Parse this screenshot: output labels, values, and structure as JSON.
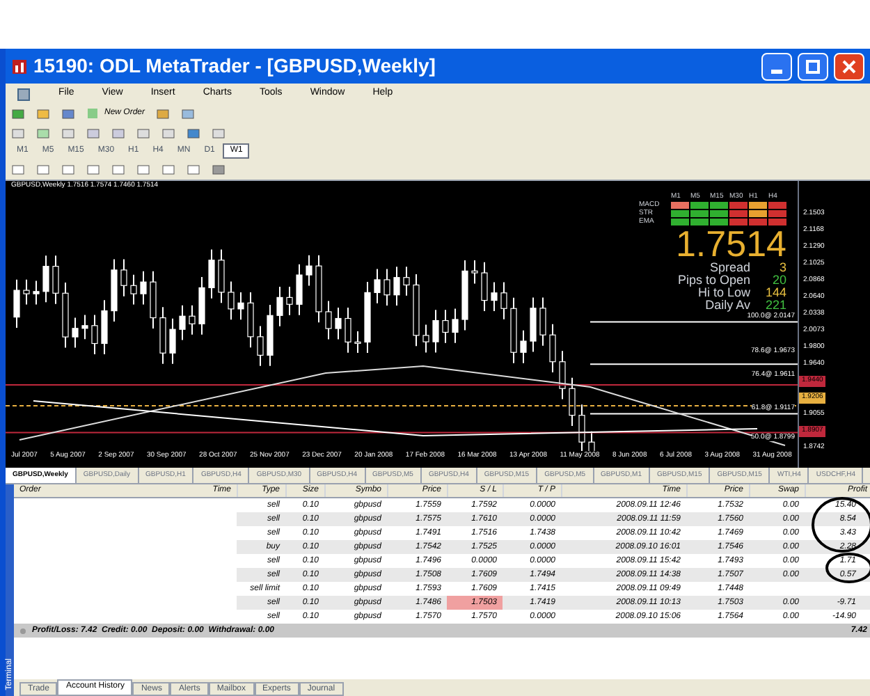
{
  "window": {
    "title": "15190: ODL MetaTrader - [GBPUSD,Weekly]"
  },
  "menu": [
    "File",
    "View",
    "Insert",
    "Charts",
    "Tools",
    "Window",
    "Help"
  ],
  "toolbar": {
    "new_order": "New Order"
  },
  "periods": [
    {
      "label": "M1",
      "selected": false
    },
    {
      "label": "M5",
      "selected": false
    },
    {
      "label": "M15",
      "selected": false
    },
    {
      "label": "M30",
      "selected": false
    },
    {
      "label": "H1",
      "selected": false
    },
    {
      "label": "H4",
      "selected": false
    },
    {
      "label": "MN",
      "selected": false
    },
    {
      "label": "D1",
      "selected": false
    },
    {
      "label": "W1",
      "selected": true
    }
  ],
  "chart": {
    "header": "GBPUSD,Weekly 1.7516 1.7574 1.7460 1.7514",
    "y_labels": [
      {
        "text": "2.1503",
        "kind": "tick"
      },
      {
        "text": "2.1168",
        "kind": "tick"
      },
      {
        "text": "2.1290",
        "kind": "tick"
      },
      {
        "text": "2.1025",
        "kind": "tick"
      },
      {
        "text": "2.0868",
        "kind": "tick"
      },
      {
        "text": "2.0640",
        "kind": "tick"
      },
      {
        "text": "2.0338",
        "kind": "tick"
      },
      {
        "text": "2.0073",
        "kind": "tick"
      },
      {
        "text": "1.9800",
        "kind": "tick"
      },
      {
        "text": "1.9640",
        "kind": "tick"
      },
      {
        "text": "1.9440",
        "kind": "badge",
        "color": "#c0283c"
      },
      {
        "text": "1.9206",
        "kind": "badge",
        "color": "#e8b040"
      },
      {
        "text": "1.9055",
        "kind": "tick"
      },
      {
        "text": "1.8907",
        "kind": "badge",
        "color": "#c0283c"
      },
      {
        "text": "1.8742",
        "kind": "tick"
      }
    ],
    "x_labels": [
      "Jul 2007",
      "5 Aug 2007",
      "2 Sep 2007",
      "30 Sep 2007",
      "28 Oct 2007",
      "25 Nov 2007",
      "23 Dec 2007",
      "20 Jan 2008",
      "17 Feb 2008",
      "16 Mar 2008",
      "13 Apr 2008",
      "11 May 2008",
      "8 Jun 2008",
      "6 Jul 2008",
      "3 Aug 2008",
      "31 Aug 2008"
    ],
    "fib_labels": [
      "100.0@ 2.0147",
      "78.6@ 1.9673",
      "76.4@ 1.9611",
      "61.8@ 1.9117",
      "50.0@ 1.8799"
    ],
    "signals": {
      "timeframes": [
        "M1",
        "M5",
        "M15",
        "M30",
        "H1",
        "H4"
      ],
      "rows": [
        {
          "name": "MACD",
          "cells": [
            {
              "color": "#e87060"
            },
            {
              "color": "#30b030"
            },
            {
              "color": "#30b030"
            },
            {
              "color": "#d03030"
            },
            {
              "color": "#e8a030"
            },
            {
              "color": "#d03030"
            }
          ]
        },
        {
          "name": "STR",
          "cells": [
            {
              "color": "#30b030"
            },
            {
              "color": "#30b030"
            },
            {
              "color": "#30b030"
            },
            {
              "color": "#d03030"
            },
            {
              "color": "#e8a030"
            },
            {
              "color": "#d03030"
            }
          ]
        },
        {
          "name": "EMA",
          "cells": [
            {
              "color": "#30b030"
            },
            {
              "color": "#30b030"
            },
            {
              "color": "#30b030"
            },
            {
              "color": "#d03030"
            },
            {
              "color": "#d03030"
            },
            {
              "color": "#d03030"
            }
          ]
        }
      ]
    },
    "price": "1.7514",
    "stats": [
      {
        "label": "Spread",
        "value": "3",
        "color": "#e8c040"
      },
      {
        "label": "Pips to Open",
        "value": "20",
        "color": "#40c040"
      },
      {
        "label": "Hi to Low",
        "value": "144",
        "color": "#e8c040"
      },
      {
        "label": "Daily Av",
        "value": "221",
        "color": "#40c040"
      }
    ]
  },
  "chart_tabs": [
    {
      "label": "GBPUSD,Weekly",
      "selected": true
    },
    {
      "label": "GBPUSD,Daily",
      "selected": false
    },
    {
      "label": "GBPUSD,H1",
      "selected": false
    },
    {
      "label": "GBPUSD,H4",
      "selected": false
    },
    {
      "label": "GBPUSD,M30",
      "selected": false
    },
    {
      "label": "GBPUSD,H4",
      "selected": false
    },
    {
      "label": "GBPUSD,M5",
      "selected": false
    },
    {
      "label": "GBPUSD,H4",
      "selected": false
    },
    {
      "label": "GBPUSD,M15",
      "selected": false
    },
    {
      "label": "GBPUSD,M5",
      "selected": false
    },
    {
      "label": "GBPUSD,M1",
      "selected": false
    },
    {
      "label": "GBPUSD,M15",
      "selected": false
    },
    {
      "label": "GBPUSD,M15",
      "selected": false
    },
    {
      "label": "WTI,H4",
      "selected": false
    },
    {
      "label": "USDCHF,H4",
      "selected": false
    }
  ],
  "table": {
    "columns": [
      "Order",
      "Time",
      "Type",
      "Size",
      "Symbo",
      "Price",
      "S / L",
      "T / P",
      "Time",
      "Price",
      "Swap",
      "Profit"
    ],
    "rows": [
      {
        "cells": [
          "",
          "",
          "sell",
          "0.10",
          "gbpusd",
          "1.7559",
          "1.7592",
          "0.0000",
          "2008.09.11 12:46",
          "1.7532",
          "0.00",
          "15.40"
        ],
        "sl_hit": false
      },
      {
        "cells": [
          "",
          "",
          "sell",
          "0.10",
          "gbpusd",
          "1.7575",
          "1.7610",
          "0.0000",
          "2008.09.11 11:59",
          "1.7560",
          "0.00",
          "8.54"
        ],
        "sl_hit": false
      },
      {
        "cells": [
          "",
          "",
          "sell",
          "0.10",
          "gbpusd",
          "1.7491",
          "1.7516",
          "1.7438",
          "2008.09.11 10:42",
          "1.7469",
          "0.00",
          "3.43"
        ],
        "sl_hit": false
      },
      {
        "cells": [
          "",
          "",
          "buy",
          "0.10",
          "gbpusd",
          "1.7542",
          "1.7525",
          "0.0000",
          "2008.09.10 16:01",
          "1.7546",
          "0.00",
          "2.28"
        ],
        "sl_hit": false
      },
      {
        "cells": [
          "",
          "",
          "sell",
          "0.10",
          "gbpusd",
          "1.7496",
          "0.0000",
          "0.0000",
          "2008.09.11 15:42",
          "1.7493",
          "0.00",
          "1.71"
        ],
        "sl_hit": false
      },
      {
        "cells": [
          "",
          "",
          "sell",
          "0.10",
          "gbpusd",
          "1.7508",
          "1.7609",
          "1.7494",
          "2008.09.11 14:38",
          "1.7507",
          "0.00",
          "0.57"
        ],
        "sl_hit": false
      },
      {
        "cells": [
          "",
          "",
          "sell limit",
          "0.10",
          "gbpusd",
          "1.7593",
          "1.7609",
          "1.7415",
          "2008.09.11 09:49",
          "1.7448"
        ],
        "sl_hit": false
      },
      {
        "cells": [
          "",
          "",
          "sell",
          "0.10",
          "gbpusd",
          "1.7486",
          "1.7503",
          "1.7419",
          "2008.09.11 10:13",
          "1.7503",
          "0.00",
          "-9.71"
        ],
        "sl_hit": true
      },
      {
        "cells": [
          "",
          "",
          "sell",
          "0.10",
          "gbpusd",
          "1.7570",
          "1.7570",
          "0.0000",
          "2008.09.10 15:06",
          "1.7564",
          "0.00",
          "-14.90"
        ],
        "sl_hit": false
      }
    ],
    "summary": "Profit/Loss: 7.42  Credit: 0.00  Deposit: 0.00  Withdrawal: 0.00",
    "total": "7.42"
  },
  "terminal_label": "Terminal",
  "bottom_tabs": [
    {
      "label": "Trade",
      "selected": false
    },
    {
      "label": "Account History",
      "selected": true
    },
    {
      "label": "News",
      "selected": false
    },
    {
      "label": "Alerts",
      "selected": false
    },
    {
      "label": "Mailbox",
      "selected": false
    },
    {
      "label": "Experts",
      "selected": false
    },
    {
      "label": "Journal",
      "selected": false
    }
  ]
}
